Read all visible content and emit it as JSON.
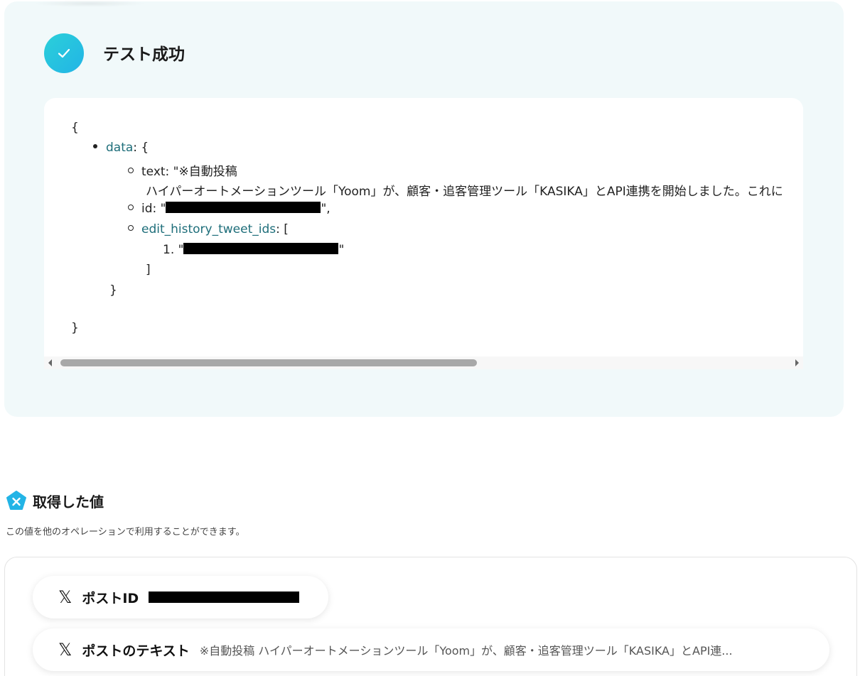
{
  "result": {
    "status_title": "テスト成功",
    "code": {
      "open_brace": "{",
      "data_key": "data",
      "data_open": ": {",
      "text_prefix": "text: \"※自動投稿",
      "text_continuation": "ハイパーオートメーションツール「Yoom」が、顧客・追客管理ツール「KASIKA」とAPI連携を開始しました。これに",
      "id_prefix": "id: \"",
      "id_suffix": "\",",
      "edit_key": "edit_history_tweet_ids",
      "edit_open": ": [",
      "list_item_prefix": "1. \"",
      "list_item_suffix": "\"",
      "list_close": "]",
      "data_close": "}",
      "close_brace": "}"
    }
  },
  "values": {
    "title": "取得した値",
    "description": "この値を他のオペレーションで利用することができます。",
    "items": [
      {
        "icon": "x-logo-icon",
        "label": "ポストID",
        "value": ""
      },
      {
        "icon": "x-logo-icon",
        "label": "ポストのテキスト",
        "value": "※自動投稿 ハイパーオートメーションツール「Yoom」が、顧客・追客管理ツール「KASIKA」とAPI連..."
      }
    ]
  },
  "colors": {
    "panel_bg": "#f1f9fa",
    "accent": "#22b4e6",
    "json_key": "#1e6e7a"
  }
}
